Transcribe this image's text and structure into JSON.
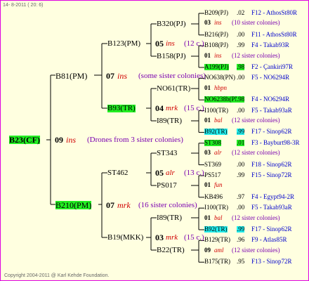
{
  "header": {
    "date": "14- 8-2011 ( 20: 6)"
  },
  "footer": {
    "copyright": "Copyright 2004-2011 @ Karl Kehde Foundation."
  },
  "root": {
    "name": "B23(CF)",
    "year": "09",
    "mark": "ins",
    "note": "(Drones from 3 sister colonies)"
  },
  "sire": {
    "name": "B81(PM)",
    "year": "07",
    "mark": "ins",
    "note": "(some sister colonies)"
  },
  "dam": {
    "name": "B210(PM)",
    "year": "07",
    "mark": "mrk",
    "note": "(16 sister colonies)"
  },
  "g3": [
    {
      "name": "B123(PM)",
      "year": "05",
      "mark": "ins",
      "note": "(12 c.)"
    },
    {
      "name": "B93(TR)",
      "year": "04",
      "mark": "mrk",
      "note": "(15 c.)"
    },
    {
      "name": "ST462",
      "year": "05",
      "mark": "alr",
      "note": "(13 c.)"
    },
    {
      "name": "B19(MKK)",
      "year": "03",
      "mark": "mrk",
      "note": "(15 c.)"
    }
  ],
  "g4": [
    "B320(PJ)",
    "B158(PJ)",
    "NO61(TR)",
    "I89(TR)",
    "ST343",
    "PS017",
    "I89(TR)",
    "B22(TR)"
  ],
  "g5": [
    {
      "name": "B209(PJ)",
      "val": ".02",
      "right": "F12 - AthosSt80R"
    },
    {
      "year": "03",
      "mark": "ins",
      "note": "(10 sister colonies)"
    },
    {
      "name": "B216(PJ)",
      "val": ".00",
      "right": "F11 - AthosSt80R"
    },
    {
      "name": "B108(PJ)",
      "val": ".99",
      "right": "F4 - Takab93R"
    },
    {
      "year": "01",
      "mark": "ins",
      "note": "(12 sister colonies)"
    },
    {
      "name": "A199(PJ)",
      "val": ".98",
      "right": "F2 - Çankiri97R"
    },
    {
      "name": "NO638(PN)",
      "val": ".00",
      "right": "F5 - NO6294R"
    },
    {
      "year": "01",
      "mark": "hbpn",
      "note": ""
    },
    {
      "name": "NO6238b(PN)",
      "val": ".98",
      "right": "F4 - NO6294R"
    },
    {
      "name": "I100(TR)",
      "val": ".00",
      "right": "F5 - Takab93aR"
    },
    {
      "year": "01",
      "mark": "bal",
      "note": "(12 sister colonies)"
    },
    {
      "name": "B92(TR)",
      "val": ".99",
      "right": "F17 - Sinop62R"
    },
    {
      "name": "ST308",
      "val": ".01",
      "right": "F3 - Bayburt98-3R"
    },
    {
      "year": "03",
      "mark": "alr",
      "note": "(12 sister colonies)"
    },
    {
      "name": "ST369",
      "val": ".00",
      "right": "F18 - Sinop62R"
    },
    {
      "name": "PS517",
      "val": ".99",
      "right": "F15 - Sinop72R"
    },
    {
      "year": "01",
      "mark": "fun",
      "note": ""
    },
    {
      "name": "KB496",
      "val": ".97",
      "right": "F4 - Egypt94-2R"
    },
    {
      "name": "I100(TR)",
      "val": ".00",
      "right": "F5 - Takab93aR"
    },
    {
      "year": "01",
      "mark": "bal",
      "note": "(12 sister colonies)"
    },
    {
      "name": "B92(TR)",
      "val": ".99",
      "right": "F17 - Sinop62R"
    },
    {
      "name": "B129(TR)",
      "val": ".96",
      "right": "F9 - Atlas85R"
    },
    {
      "year": "09",
      "mark": "aml",
      "note": "(12 sister colonies)"
    },
    {
      "name": "B175(TR)",
      "val": ".95",
      "right": "F13 - Sinop72R"
    }
  ]
}
